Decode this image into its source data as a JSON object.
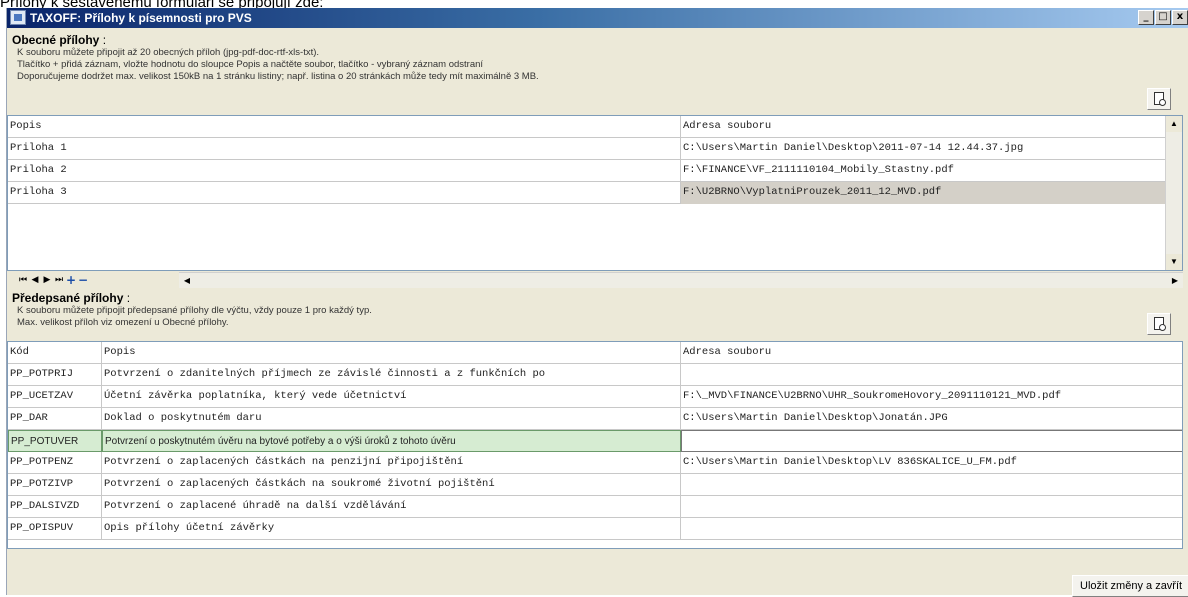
{
  "page_caption": "Přílohy k sestavenému formuláři se připojují zde:",
  "window": {
    "title": "TAXOFF: Přílohy k písemnosti pro PVS",
    "controls": {
      "minimize": "_",
      "maximize": "□",
      "close": "x"
    }
  },
  "general": {
    "title_bold": "Obecné přílohy",
    "title_rest": " :",
    "info": [
      "K souboru můžete připojit až 20 obecných příloh (jpg-pdf-doc-rtf-xls-txt).",
      "Tlačítko + přidá záznam, vložte hodnotu do sloupce Popis a načtěte soubor, tlačítko - vybraný záznam odstraní",
      "Doporučujeme dodržet max. velikost 150kB na 1 stránku listiny; např. listina o 20 stránkách může tedy mít maximálně 3 MB."
    ],
    "headers": {
      "popis": "Popis",
      "adresa": "Adresa souboru"
    },
    "rows": [
      {
        "popis": "Priloha 1",
        "adresa": "C:\\Users\\Martin Daniel\\Desktop\\2011-07-14 12.44.37.jpg"
      },
      {
        "popis": "Priloha 2",
        "adresa": "F:\\FINANCE\\VF_2111110104_Mobily_Stastny.pdf"
      },
      {
        "popis": "Priloha 3",
        "adresa": "F:\\U2BRNO\\VyplatniProuzek_2011_12_MVD.pdf"
      }
    ],
    "navigator": {
      "first": "⏮",
      "prev": "◀",
      "next": "▶",
      "last": "⏭",
      "add": "+",
      "delete": "−"
    }
  },
  "required": {
    "title_bold": "Předepsané přílohy",
    "title_rest": " :",
    "info": [
      "K souboru můžete připojit předepsané přílohy dle výčtu, vždy pouze 1 pro každý typ.",
      "Max. velikost příloh viz omezení u Obecné přílohy."
    ],
    "headers": {
      "kod": "Kód",
      "popis": "Popis",
      "adresa": "Adresa souboru"
    },
    "rows": [
      {
        "kod": "PP_POTPRIJ",
        "popis": "Potvrzení o zdanitelných příjmech ze závislé činnosti a z funkčních po",
        "adresa": ""
      },
      {
        "kod": "PP_UCETZAV",
        "popis": "Účetní závěrka poplatníka, který vede účetnictví",
        "adresa": "F:\\_MVD\\FINANCE\\U2BRNO\\UHR_SoukromeHovory_2091110121_MVD.pdf"
      },
      {
        "kod": "PP_DAR",
        "popis": "Doklad o poskytnutém daru",
        "adresa": "C:\\Users\\Martin Daniel\\Desktop\\Jonatán.JPG"
      },
      {
        "kod": "PP_POTUVER",
        "popis": "Potvrzení o poskytnutém úvěru na bytové potřeby a o výši úroků z tohoto úvěru",
        "adresa": ""
      },
      {
        "kod": "PP_POTPENZ",
        "popis": "Potvrzení o zaplacených částkách na penzijní připojištění",
        "adresa": "C:\\Users\\Martin Daniel\\Desktop\\LV 836SKALICE_U_FM.pdf"
      },
      {
        "kod": "PP_POTZIVP",
        "popis": "Potvrzení o zaplacených částkách na soukromé životní pojištění",
        "adresa": ""
      },
      {
        "kod": "PP_DALSIVZD",
        "popis": "Potvrzení o zaplacené úhradě na další vzdělávání",
        "adresa": ""
      },
      {
        "kod": "PP_OPISPUV",
        "popis": "Opis přílohy účetní závěrky",
        "adresa": ""
      }
    ]
  },
  "save_button": "Uložit změny a zavřít"
}
